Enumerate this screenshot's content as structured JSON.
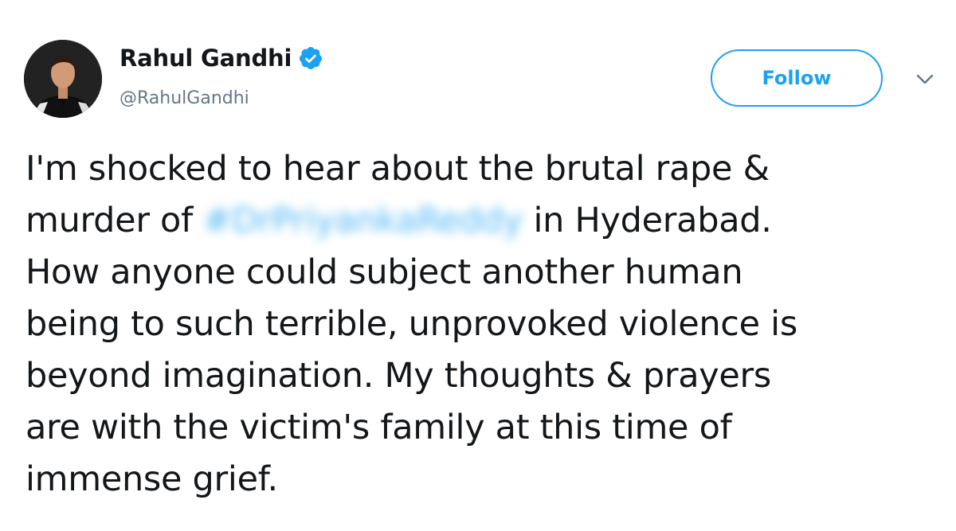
{
  "author": {
    "display_name": "Rahul Gandhi",
    "handle": "@RahulGandhi",
    "verified": true
  },
  "actions": {
    "follow_label": "Follow",
    "menu_icon": "chevron-down-icon"
  },
  "tweet": {
    "line1": "I'm shocked to hear about the brutal rape &",
    "line2_prefix": "murder of",
    "hashtag": "#DrPriyankaReddy",
    "line2_suffix": "in Hyderabad.",
    "line3": "How anyone could subject another human",
    "line4": "being to such terrible, unprovoked violence is",
    "line5": "beyond imagination. My thoughts & prayers",
    "line6": "are with the victim's family at this time of",
    "line7": "immense grief."
  },
  "colors": {
    "accent": "#1da1f2",
    "text": "#14171a",
    "secondary": "#657786"
  }
}
